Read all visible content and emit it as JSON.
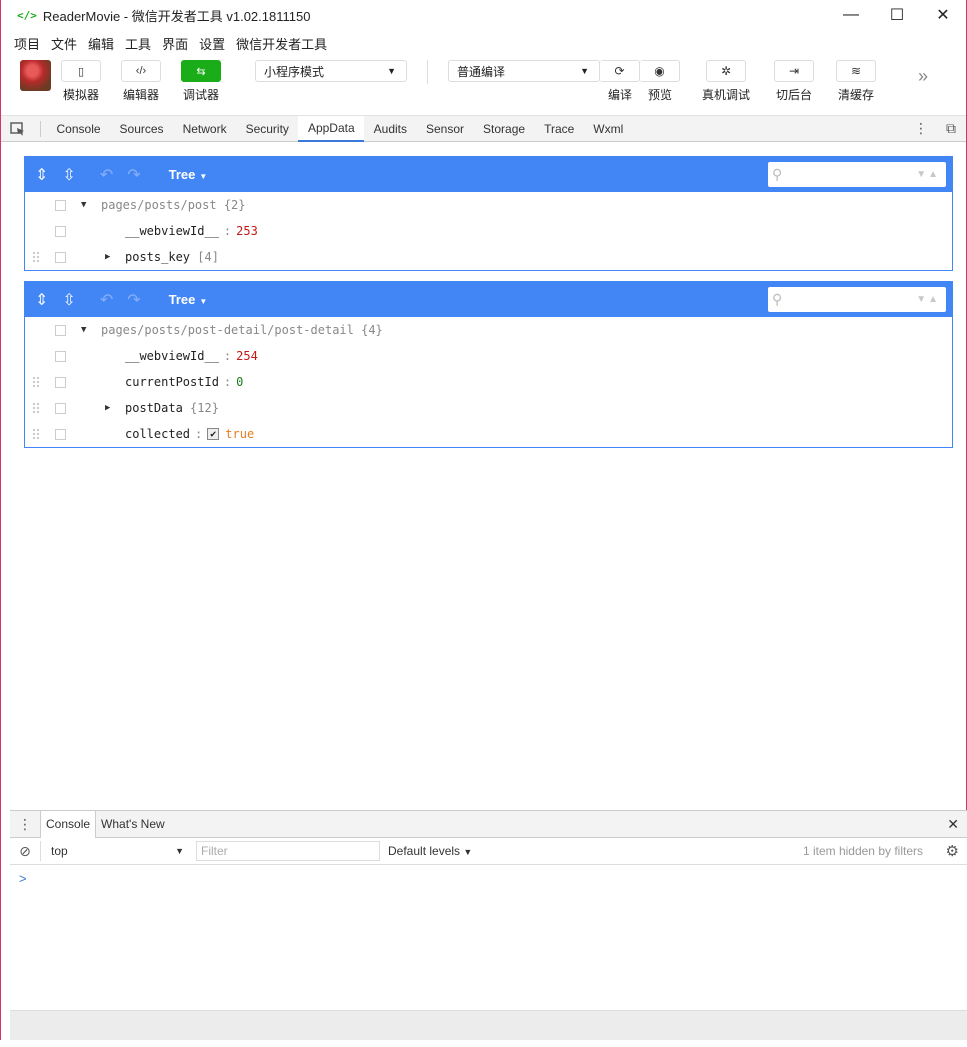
{
  "window": {
    "app_icon": "</>",
    "title": "ReaderMovie - 微信开发者工具 v1.02.1811150",
    "controls": {
      "minimize": "—",
      "maximize": "☐",
      "close": "✕"
    }
  },
  "menu": [
    "项目",
    "文件",
    "编辑",
    "工具",
    "界面",
    "设置",
    "微信开发者工具"
  ],
  "toolbar": {
    "left_buttons": [
      {
        "icon": "phone-icon",
        "glyph": "▯",
        "label": "模拟器"
      },
      {
        "icon": "code-icon",
        "glyph": "‹/›",
        "label": "编辑器"
      },
      {
        "icon": "debug-icon",
        "glyph": "⇆",
        "label": "调试器"
      }
    ],
    "mode_select": "小程序模式",
    "compile_select": "普通编译",
    "right_buttons": [
      {
        "icon": "refresh-icon",
        "glyph": "⟳",
        "label": "编译"
      },
      {
        "icon": "eye-icon",
        "glyph": "◉",
        "label": "预览"
      },
      {
        "icon": "bug-icon",
        "glyph": "✲",
        "label": "真机调试"
      },
      {
        "icon": "switch-icon",
        "glyph": "⇥",
        "label": "切后台"
      },
      {
        "icon": "layers-icon",
        "glyph": "≋",
        "label": "清缓存"
      }
    ],
    "more": "»"
  },
  "devtools_tabs": [
    "Console",
    "Sources",
    "Network",
    "Security",
    "AppData",
    "Audits",
    "Sensor",
    "Storage",
    "Trace",
    "Wxml"
  ],
  "active_tab": "AppData",
  "panels": [
    {
      "mode": "Tree",
      "root": {
        "path": "pages/posts/post",
        "count": "{2}"
      },
      "rows": [
        {
          "key": "__webviewId__",
          "value": "253",
          "type": "number"
        },
        {
          "key": "posts_key",
          "value": "[4]",
          "type": "collapsed"
        }
      ]
    },
    {
      "mode": "Tree",
      "root": {
        "path": "pages/posts/post-detail/post-detail",
        "count": "{4}"
      },
      "rows": [
        {
          "key": "__webviewId__",
          "value": "254",
          "type": "number"
        },
        {
          "key": "currentPostId",
          "value": "0",
          "type": "number0"
        },
        {
          "key": "postData",
          "value": "{12}",
          "type": "collapsed"
        },
        {
          "key": "collected",
          "value": "true",
          "type": "bool"
        }
      ]
    }
  ],
  "drawer": {
    "tabs": [
      "Console",
      "What's New"
    ],
    "context": "top",
    "filter_placeholder": "Filter",
    "levels": "Default levels",
    "hidden_info": "1 item hidden by filters",
    "prompt": ">"
  }
}
